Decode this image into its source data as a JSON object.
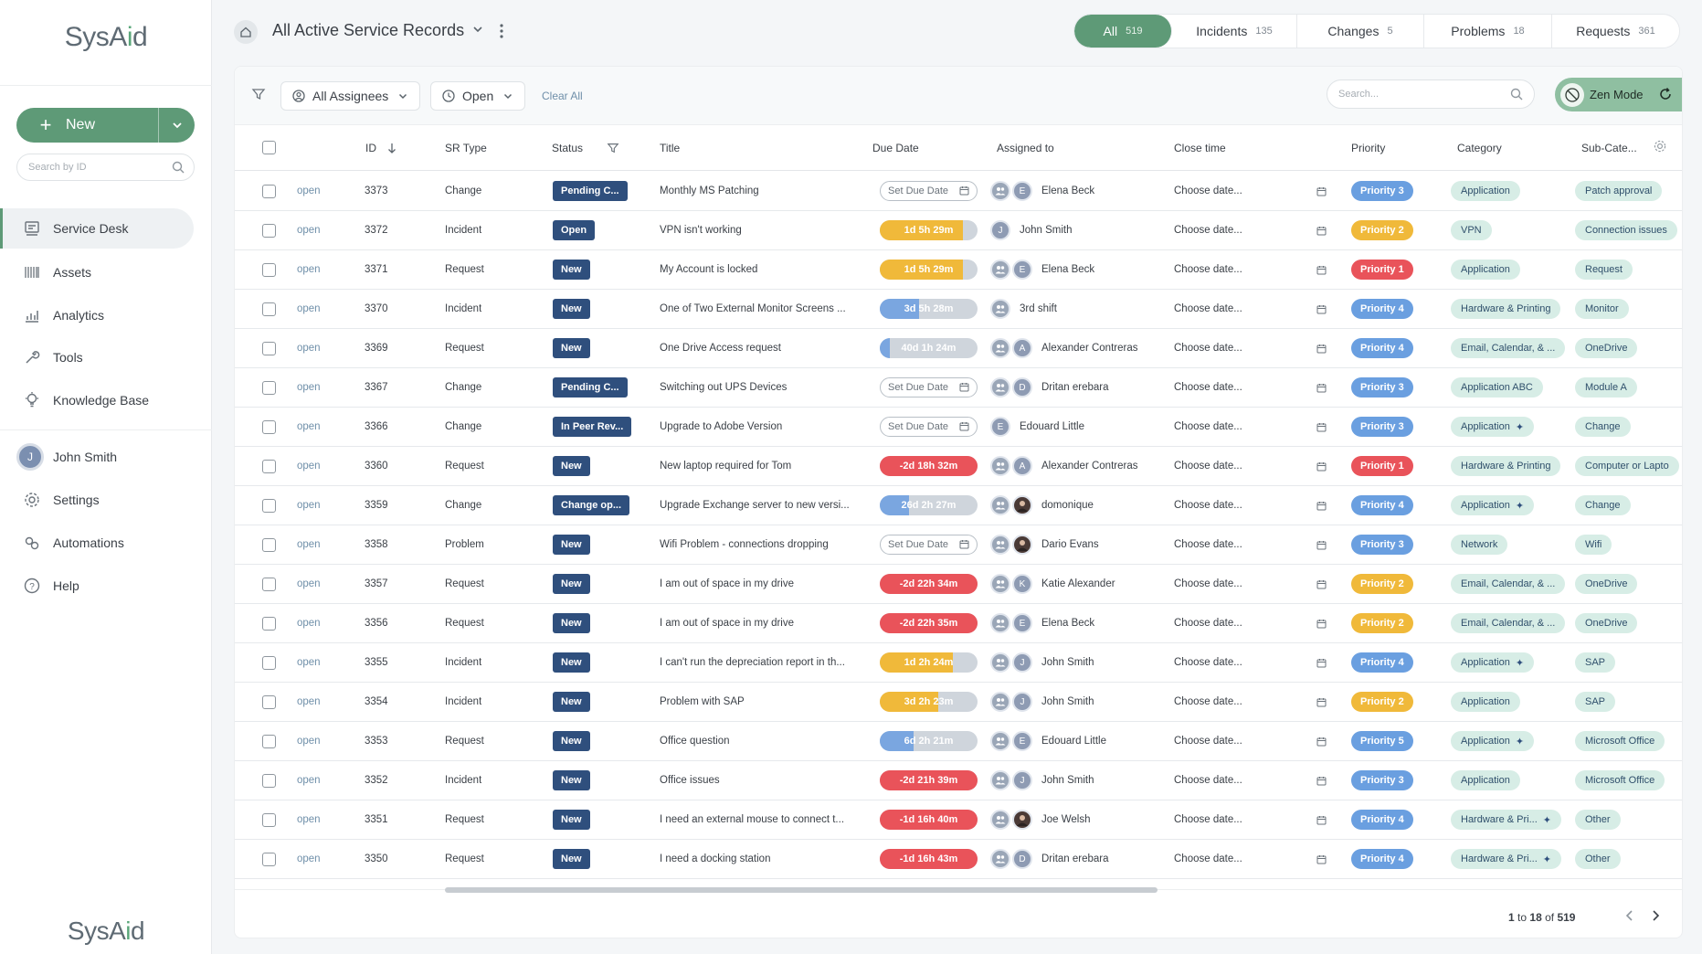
{
  "sidebar": {
    "logo": "SysAid",
    "new_label": "New",
    "search_placeholder": "Search by ID",
    "nav_items": [
      {
        "label": "Service Desk",
        "icon": "service-desk-icon",
        "active": true
      },
      {
        "label": "Assets",
        "icon": "assets-icon"
      },
      {
        "label": "Analytics",
        "icon": "analytics-icon"
      },
      {
        "label": "Tools",
        "icon": "tools-icon"
      },
      {
        "label": "Knowledge Base",
        "icon": "lightbulb-icon"
      }
    ],
    "user": {
      "name": "John Smith",
      "initial": "J"
    },
    "bottom_items": [
      {
        "label": "Settings",
        "icon": "gear-icon"
      },
      {
        "label": "Automations",
        "icon": "automations-icon"
      },
      {
        "label": "Help",
        "icon": "help-icon"
      }
    ],
    "footer_logo": "SysAid"
  },
  "header": {
    "view_title": "All Active Service Records",
    "tabs": [
      {
        "label": "All",
        "count": "519",
        "active": true
      },
      {
        "label": "Incidents",
        "count": "135"
      },
      {
        "label": "Changes",
        "count": "5"
      },
      {
        "label": "Problems",
        "count": "18"
      },
      {
        "label": "Requests",
        "count": "361"
      }
    ]
  },
  "filters": {
    "assignees": "All Assignees",
    "state": "Open",
    "clear_all": "Clear All",
    "search_placeholder": "Search...",
    "zen_mode": "Zen Mode"
  },
  "columns": [
    "ID",
    "SR Type",
    "Status",
    "Title",
    "Due Date",
    "Assigned to",
    "Close time",
    "Priority",
    "Category",
    "Sub-Cate..."
  ],
  "colors": {
    "accent": "#5e9a77",
    "status": "#2f4f7d",
    "p1": "#e9535a",
    "p2": "#f0b93a",
    "p3": "#6a9fe0",
    "due_red": "#e9535a",
    "due_orange": "#f0b93a",
    "due_blue": "#7aa6e0"
  },
  "rows": [
    {
      "state": "open",
      "id": "3373",
      "type": "Change",
      "status": "Pending C...",
      "title": "Monthly MS Patching",
      "due": "Set Due Date",
      "due_kind": "set",
      "due_fill": 0,
      "group": true,
      "initial": "E",
      "assignee": "Elena Beck",
      "close": "Choose date...",
      "priority": "Priority 3",
      "pkind": "p3",
      "category": "Application",
      "cat_ai": false,
      "sub": "Patch approval",
      "sub_ai": false
    },
    {
      "state": "open",
      "id": "3372",
      "type": "Incident",
      "status": "Open",
      "title": "VPN isn't working",
      "due": "1d 5h 29m",
      "due_kind": "orange",
      "due_fill": 0.85,
      "group": false,
      "initial": "J",
      "assignee": "John Smith",
      "close": "Choose date...",
      "priority": "Priority 2",
      "pkind": "p2",
      "category": "VPN",
      "cat_ai": false,
      "sub": "Connection issues",
      "sub_ai": false
    },
    {
      "state": "open",
      "id": "3371",
      "type": "Request",
      "status": "New",
      "title": "My Account is locked",
      "due": "1d 5h 29m",
      "due_kind": "orange",
      "due_fill": 0.85,
      "group": true,
      "initial": "E",
      "assignee": "Elena Beck",
      "close": "Choose date...",
      "priority": "Priority 1",
      "pkind": "p1",
      "category": "Application",
      "cat_ai": false,
      "sub": "Request",
      "sub_ai": false
    },
    {
      "state": "open",
      "id": "3370",
      "type": "Incident",
      "status": "New",
      "title": "One of Two External Monitor Screens ...",
      "due": "3d 5h 28m",
      "due_kind": "blue",
      "due_fill": 0.4,
      "group": true,
      "initial": "",
      "assignee": "3rd shift",
      "close": "Choose date...",
      "priority": "Priority 4",
      "pkind": "p3",
      "category": "Hardware & Printing",
      "cat_ai": false,
      "sub": "Monitor",
      "sub_ai": false
    },
    {
      "state": "open",
      "id": "3369",
      "type": "Request",
      "status": "New",
      "title": "One Drive Access request",
      "due": "40d 1h 24m",
      "due_kind": "blue",
      "due_fill": 0.1,
      "group": true,
      "initial": "A",
      "assignee": "Alexander Contreras",
      "close": "Choose date...",
      "priority": "Priority 4",
      "pkind": "p3",
      "category": "Email, Calendar, & ...",
      "cat_ai": false,
      "sub": "OneDrive",
      "sub_ai": false
    },
    {
      "state": "open",
      "id": "3367",
      "type": "Change",
      "status": "Pending C...",
      "title": "Switching out UPS Devices",
      "due": "Set Due Date",
      "due_kind": "set",
      "due_fill": 0,
      "group": true,
      "initial": "D",
      "assignee": "Dritan erebara",
      "close": "Choose date...",
      "priority": "Priority 3",
      "pkind": "p3",
      "category": "Application ABC",
      "cat_ai": false,
      "sub": "Module A",
      "sub_ai": false
    },
    {
      "state": "open",
      "id": "3366",
      "type": "Change",
      "status": "In Peer Rev...",
      "title": "Upgrade to Adobe Version",
      "due": "Set Due Date",
      "due_kind": "set",
      "due_fill": 0,
      "group": false,
      "initial": "E",
      "assignee": "Edouard Little",
      "close": "Choose date...",
      "priority": "Priority 3",
      "pkind": "p3",
      "category": "Application",
      "cat_ai": true,
      "sub": "Change",
      "sub_ai": false
    },
    {
      "state": "open",
      "id": "3360",
      "type": "Request",
      "status": "New",
      "title": "New laptop required for Tom",
      "due": "-2d 18h 32m",
      "due_kind": "red",
      "due_fill": 1,
      "group": true,
      "initial": "A",
      "assignee": "Alexander Contreras",
      "close": "Choose date...",
      "priority": "Priority 1",
      "pkind": "p1",
      "category": "Hardware & Printing",
      "cat_ai": false,
      "sub": "Computer or Lapto",
      "sub_ai": false
    },
    {
      "state": "open",
      "id": "3359",
      "type": "Change",
      "status": "Change op...",
      "title": "Upgrade Exchange server to new versi...",
      "due": "26d 2h 27m",
      "due_kind": "blue",
      "due_fill": 0.3,
      "group": true,
      "initial": "photo",
      "assignee": "domonique",
      "close": "Choose date...",
      "priority": "Priority 4",
      "pkind": "p3",
      "category": "Application",
      "cat_ai": true,
      "sub": "Change",
      "sub_ai": false
    },
    {
      "state": "open",
      "id": "3358",
      "type": "Problem",
      "status": "New",
      "title": "Wifi Problem - connections dropping",
      "due": "Set Due Date",
      "due_kind": "set",
      "due_fill": 0,
      "group": true,
      "initial": "photo",
      "assignee": "Dario Evans",
      "close": "Choose date...",
      "priority": "Priority 3",
      "pkind": "p3",
      "category": "Network",
      "cat_ai": false,
      "sub": "Wifi",
      "sub_ai": false
    },
    {
      "state": "open",
      "id": "3357",
      "type": "Request",
      "status": "New",
      "title": "I am out of space in my drive",
      "due": "-2d 22h 34m",
      "due_kind": "red",
      "due_fill": 1,
      "group": true,
      "initial": "K",
      "assignee": "Katie Alexander",
      "close": "Choose date...",
      "priority": "Priority 2",
      "pkind": "p2",
      "category": "Email, Calendar, & ...",
      "cat_ai": false,
      "sub": "OneDrive",
      "sub_ai": false
    },
    {
      "state": "open",
      "id": "3356",
      "type": "Request",
      "status": "New",
      "title": "I am out of space in my drive",
      "due": "-2d 22h 35m",
      "due_kind": "red",
      "due_fill": 1,
      "group": true,
      "initial": "E",
      "assignee": "Elena Beck",
      "close": "Choose date...",
      "priority": "Priority 2",
      "pkind": "p2",
      "category": "Email, Calendar, & ...",
      "cat_ai": false,
      "sub": "OneDrive",
      "sub_ai": false
    },
    {
      "state": "open",
      "id": "3355",
      "type": "Incident",
      "status": "New",
      "title": "I can't run the depreciation report in th...",
      "due": "1d 2h 24m",
      "due_kind": "orange",
      "due_fill": 0.75,
      "group": true,
      "initial": "J",
      "assignee": "John Smith",
      "close": "Choose date...",
      "priority": "Priority 4",
      "pkind": "p3",
      "category": "Application",
      "cat_ai": true,
      "sub": "SAP",
      "sub_ai": false
    },
    {
      "state": "open",
      "id": "3354",
      "type": "Incident",
      "status": "New",
      "title": "Problem with SAP",
      "due": "3d 2h 23m",
      "due_kind": "orange",
      "due_fill": 0.6,
      "group": true,
      "initial": "J",
      "assignee": "John Smith",
      "close": "Choose date...",
      "priority": "Priority 2",
      "pkind": "p2",
      "category": "Application",
      "cat_ai": false,
      "sub": "SAP",
      "sub_ai": false
    },
    {
      "state": "open",
      "id": "3353",
      "type": "Request",
      "status": "New",
      "title": "Office question",
      "due": "6d 2h 21m",
      "due_kind": "blue",
      "due_fill": 0.35,
      "group": true,
      "initial": "E",
      "assignee": "Edouard Little",
      "close": "Choose date...",
      "priority": "Priority 5",
      "pkind": "p3",
      "category": "Application",
      "cat_ai": true,
      "sub": "Microsoft Office",
      "sub_ai": false
    },
    {
      "state": "open",
      "id": "3352",
      "type": "Incident",
      "status": "New",
      "title": "Office issues",
      "due": "-2d 21h 39m",
      "due_kind": "red",
      "due_fill": 1,
      "group": true,
      "initial": "J",
      "assignee": "John Smith",
      "close": "Choose date...",
      "priority": "Priority 3",
      "pkind": "p3",
      "category": "Application",
      "cat_ai": false,
      "sub": "Microsoft Office",
      "sub_ai": false
    },
    {
      "state": "open",
      "id": "3351",
      "type": "Request",
      "status": "New",
      "title": "I need an external mouse to connect t...",
      "due": "-1d 16h 40m",
      "due_kind": "red",
      "due_fill": 1,
      "group": true,
      "initial": "photo",
      "assignee": "Joe Welsh",
      "close": "Choose date...",
      "priority": "Priority 4",
      "pkind": "p3",
      "category": "Hardware & Pri...",
      "cat_ai": true,
      "sub": "Other",
      "sub_ai": false
    },
    {
      "state": "open",
      "id": "3350",
      "type": "Request",
      "status": "New",
      "title": "I need a docking station",
      "due": "-1d 16h 43m",
      "due_kind": "red",
      "due_fill": 1,
      "group": true,
      "initial": "D",
      "assignee": "Dritan erebara",
      "close": "Choose date...",
      "priority": "Priority 4",
      "pkind": "p3",
      "category": "Hardware & Pri...",
      "cat_ai": true,
      "sub": "Other",
      "sub_ai": false
    }
  ],
  "pagination": {
    "from": "1",
    "to": "18",
    "total": "519",
    "word_to": "to",
    "word_of": "of"
  }
}
